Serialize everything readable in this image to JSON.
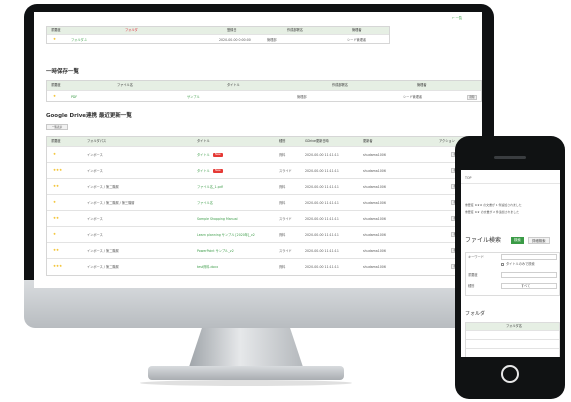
{
  "desktop": {
    "top_link": "← 一覧",
    "top_table": {
      "headers": [
        "重要度",
        "フォルダ",
        "登録日",
        "作成部署名",
        "管理者"
      ],
      "row": {
        "stars": "★",
        "name": "フォルダ-1",
        "date": "2020-00-00 0:00:00",
        "dept": "管理部",
        "owner": "シード管理者"
      }
    },
    "section1_title": "一時保存一覧",
    "t2": {
      "headers": [
        "重要度",
        "ファイル名",
        "タイトル",
        "作成部署名",
        "管理者"
      ],
      "row": {
        "stars": "★",
        "file": "PDF",
        "title": "サンプル",
        "dept": "管理部",
        "owner": "シード管理者",
        "action": "削除"
      }
    },
    "section2_title": "Google Drive連携 最近更新一覧",
    "show_all": "一覧表示",
    "t3": {
      "headers": [
        "重要度",
        "フォルダパス",
        "タイトル",
        "種別",
        "GDrive更新日時",
        "更新者",
        "アクション"
      ],
      "rows": [
        {
          "stars": "★",
          "path": "インボース",
          "title": "タイトル",
          "tag": "New",
          "type": "資料",
          "date": "2020-00-00 11:11:11",
          "user": "shudama1006",
          "a1": "参照",
          "a2": "開く"
        },
        {
          "stars": "★★★",
          "path": "インボース",
          "title": "タイトル",
          "tag": "New",
          "type": "スライド",
          "date": "2020-00-00 11:11:11",
          "user": "shudama1006",
          "a1": "参照",
          "a2": "開く"
        },
        {
          "stars": "★★",
          "path": "インボース / 第二階層",
          "title": "ファイル名_1.pdf",
          "tag": "",
          "type": "資料",
          "date": "2020-00-00 11:11:11",
          "user": "shudama1006",
          "a1": "参照",
          "a2": "開く"
        },
        {
          "stars": "★",
          "path": "インボース / 第二階層 / 第三階層",
          "title": "ファイル名",
          "tag": "",
          "type": "資料",
          "date": "2020-00-00 11:11:11",
          "user": "shudama1006",
          "a1": "参照",
          "a2": "開く"
        },
        {
          "stars": "★★",
          "path": "インボース",
          "title": "Sample Shopping Manual",
          "tag": "",
          "type": "スライド",
          "date": "2020-00-00 11:11:11",
          "user": "shudama1006",
          "a1": "参照",
          "a2": "開く"
        },
        {
          "stars": "★",
          "path": "インボース",
          "title": "Learn planning サンプル [2020年]_v2",
          "tag": "",
          "type": "資料",
          "date": "2020-00-00 11:11:11",
          "user": "shudama1006",
          "a1": "参照",
          "a2": "開く"
        },
        {
          "stars": "★★",
          "path": "インボース / 第二階層",
          "title": "PowerPoint サンプル_v2",
          "tag": "",
          "type": "スライド",
          "date": "2020-00-00 11:11:11",
          "user": "shudama1006",
          "a1": "参照",
          "a2": "開く"
        },
        {
          "stars": "★★★",
          "path": "インボース / 第二階層",
          "title": "test資料.docx",
          "tag": "",
          "type": "資料",
          "date": "2020-00-00 11:11:11",
          "user": "shudama1006",
          "a1": "参照",
          "a2": "開く"
        }
      ]
    }
  },
  "phone": {
    "top": "TOP",
    "notice1": "重要度 ★★★ の文書が 1 件追加されました",
    "notice2": "重要度 ★★ の文書が 2 件追加されました",
    "section_title": "ファイル検索",
    "btn1": "検索",
    "btn2": "詳細検索",
    "kw_label": "キーワード",
    "opt_label": "タイトルのみで検索",
    "importance_label": "重要度",
    "type_label": "種別",
    "type_value": "すべて",
    "folder_title": "フォルダ",
    "folder_header": "フォルダ名"
  },
  "colors": {
    "accent_green": "#3a9b46",
    "header_bg": "#e6efe4",
    "new_tag": "#e53935",
    "star": "#f0b400"
  }
}
